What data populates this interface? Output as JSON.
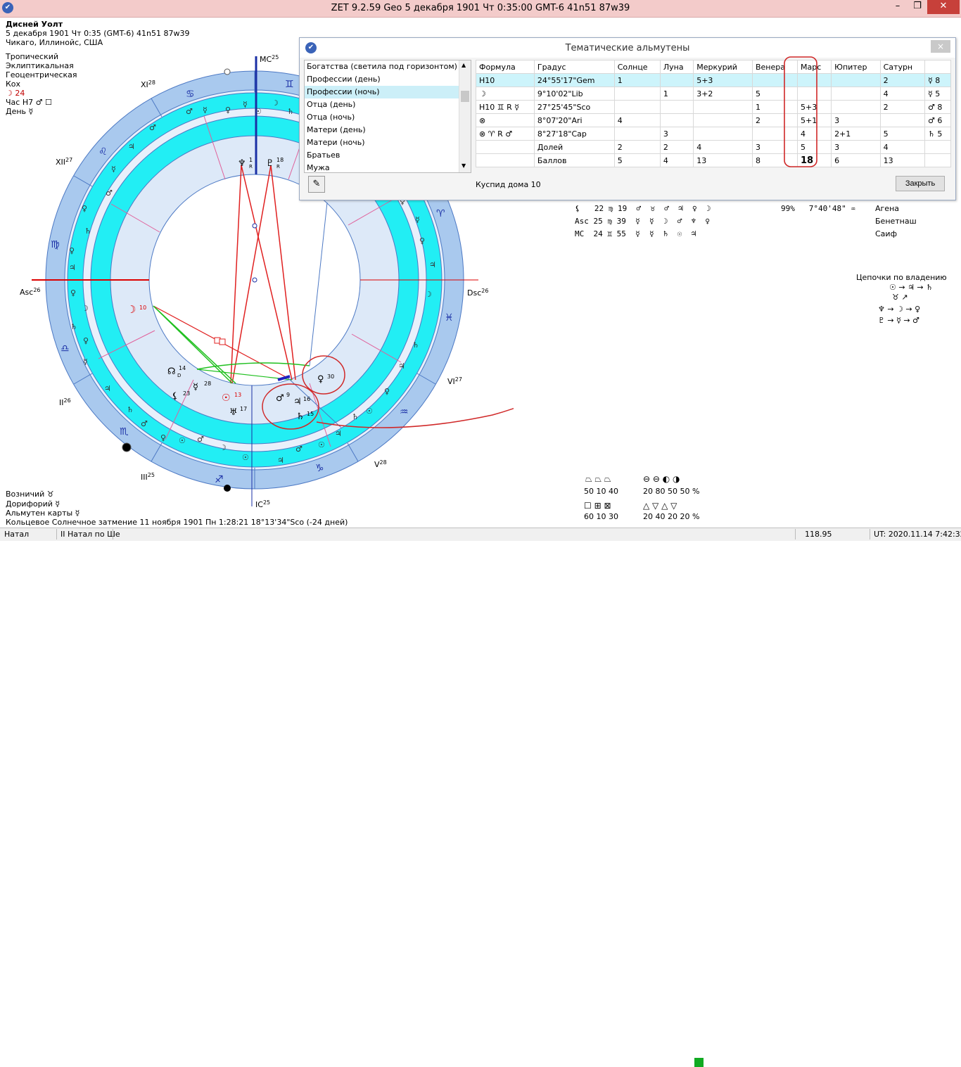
{
  "window": {
    "title": "ZET 9.2.59 Geo    5 декабря 1901  Чт   0:35:00 GMT-6 41n51  87w39"
  },
  "person": {
    "name": "Дисней Уолт",
    "line1": "5 декабря 1901  Чт   0:35 (GMT-6)  41n51  87w39",
    "line2": "Чикаго, Иллинойс, США"
  },
  "settings": [
    "Тропический",
    "Эклиптикальная",
    "Геоцентрическая",
    "Кох"
  ],
  "moon_line": "☽  24",
  "hour_line": "Час H7  ♂ ☐",
  "day_line": "День ☿",
  "bottom_left": {
    "vozn": "Возничий  ♉",
    "dorif": "Дорифорий  ☿",
    "almuten": "Альмутен карты  ☿",
    "eclipse": "Кольцевое Солнечное затмение 11 ноября 1901 Пн  1:28:21 18°13'34\"Sco (-24 дней)"
  },
  "chart_labels": {
    "mc": "MC",
    "mc_deg": "25",
    "ic": "IC",
    "ic_deg": "25",
    "asc": "Asc",
    "asc_deg": "26",
    "dsc": "Dsc",
    "dsc_deg": "26",
    "h11": "XI",
    "h11_deg": "28",
    "h12": "XII",
    "h12_deg": "27",
    "h2": "II",
    "h2_deg": "26",
    "h3": "III",
    "h3_deg": "25",
    "h5": "V",
    "h5_deg": "28",
    "h6": "VI",
    "h6_deg": "27"
  },
  "planets": {
    "moon": "☽",
    "moon_deg": "10",
    "neptune": "♆",
    "neptune_deg": "1",
    "neptune_r": "R",
    "pluto": "♇",
    "pluto_deg": "18",
    "pluto_r": "R",
    "node": "☊",
    "node_deg": "14",
    "node_d": "D",
    "mercury": "☿",
    "mercury_deg": "28",
    "lilith": "⚸",
    "lilith_deg": "23",
    "sun": "☉",
    "sun_deg": "13",
    "uranus": "♅",
    "uranus_deg": "17",
    "mars": "♂",
    "mars_deg": "9",
    "jupiter": "♃",
    "jupiter_deg": "16",
    "saturn": "♄",
    "saturn_deg": "15",
    "venus": "♀",
    "venus_deg": "30"
  },
  "dialog": {
    "title": "Тематические альмутены",
    "close_x": "×",
    "list": [
      "Богатства (светила под горизонтом)",
      "Профессии (день)",
      "Профессии (ночь)",
      "Отца (день)",
      "Отца (ночь)",
      "Матери (день)",
      "Матери (ночь)",
      "Братьев",
      "Мужа"
    ],
    "selected_index": 2,
    "headers": [
      "Формула",
      "Градус",
      "Солнце",
      "Луна",
      "Меркурий",
      "Венера",
      "Марс",
      "Юпитер",
      "Сатурн",
      ""
    ],
    "rows": [
      [
        "H10",
        "24°55'17\"Gem",
        "1",
        "",
        "5+3",
        "",
        "",
        "",
        "2",
        "☿ 8"
      ],
      [
        "☽",
        "9°10'02\"Lib",
        "",
        "1",
        "3+2",
        "5",
        "",
        "",
        "4",
        "☿ 5"
      ],
      [
        "H10 ♊ R ☿",
        "27°25'45\"Sco",
        "",
        "",
        "",
        "1",
        "5+3",
        "",
        "2",
        "♂ 8"
      ],
      [
        "⊗",
        "8°07'20\"Ari",
        "4",
        "",
        "",
        "2",
        "5+1",
        "3",
        "",
        "♂ 6"
      ],
      [
        "⊗ ♈ R ♂",
        "8°27'18\"Cap",
        "",
        "3",
        "",
        "",
        "4",
        "2+1",
        "5",
        "♄ 5"
      ],
      [
        "",
        "Долей",
        "2",
        "2",
        "4",
        "3",
        "5",
        "3",
        "4",
        ""
      ],
      [
        "",
        "Баллов",
        "5",
        "4",
        "13",
        "8",
        "18",
        "6",
        "13",
        ""
      ]
    ],
    "status": "Куспид дома 10",
    "close_btn": "Закрыть"
  },
  "right_table": [
    {
      "l": "⚸   22 ♍ 19  ♂  ♉  ♂  ♃  ♀  ☽",
      "extra": "99%   7°40'48\" ♒",
      "star": "Агена"
    },
    {
      "l": "Asc 25 ♍ 39  ☿  ☿  ☽  ♂  ♆  ♀",
      "extra": "",
      "star": "Бенетнаш"
    },
    {
      "l": "MC  24 ♊ 55  ☿  ☿  ♄  ☉  ♃",
      "extra": "",
      "star": "Саиф"
    }
  ],
  "chains": {
    "title": "Цепочки по владению",
    "l1": "☉ → ♃ → ♄",
    "l2": "♉ ↗",
    "l3": "♆ → ☽ → ♀",
    "l4": "♇ → ☿ → ♂"
  },
  "stats": {
    "r1": "50  10  40",
    "r2": "20  80  50  50 %",
    "r3": "60  10  30",
    "r4": "20  40  20  20 %"
  },
  "statusbar": {
    "s1": "Натал",
    "s2": "II Натал по Ше",
    "value": "118.95",
    "ut": "UT: 2020.11.14  7:42:32"
  }
}
